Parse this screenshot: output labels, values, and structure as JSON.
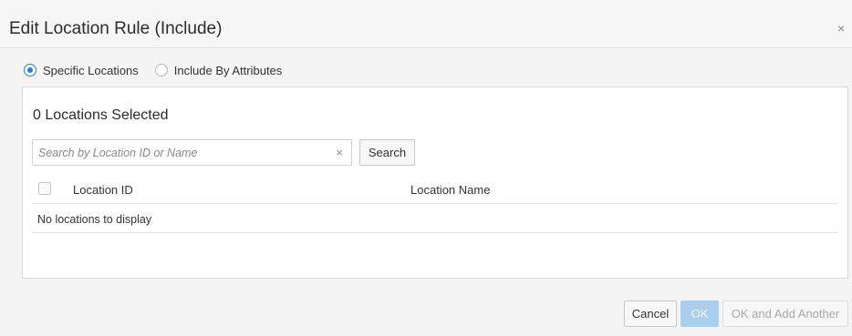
{
  "dialog": {
    "title": "Edit Location Rule (Include)",
    "close_icon": "×"
  },
  "mode": {
    "options": [
      {
        "label": "Specific Locations",
        "selected": true
      },
      {
        "label": "Include By Attributes",
        "selected": false
      }
    ]
  },
  "locations": {
    "selected_count_label": "0 Locations Selected",
    "search": {
      "placeholder": "Search by Location ID or Name",
      "value": "",
      "clear_icon": "×",
      "button_label": "Search"
    },
    "table": {
      "columns": [
        "Location ID",
        "Location Name"
      ],
      "rows": [],
      "empty_message": "No locations to display"
    }
  },
  "footer": {
    "cancel_label": "Cancel",
    "ok_label": "OK",
    "ok_add_label": "OK and Add Another"
  },
  "colors": {
    "accent": "#227ed8",
    "ok_disabled_bg": "#a8cef0"
  }
}
